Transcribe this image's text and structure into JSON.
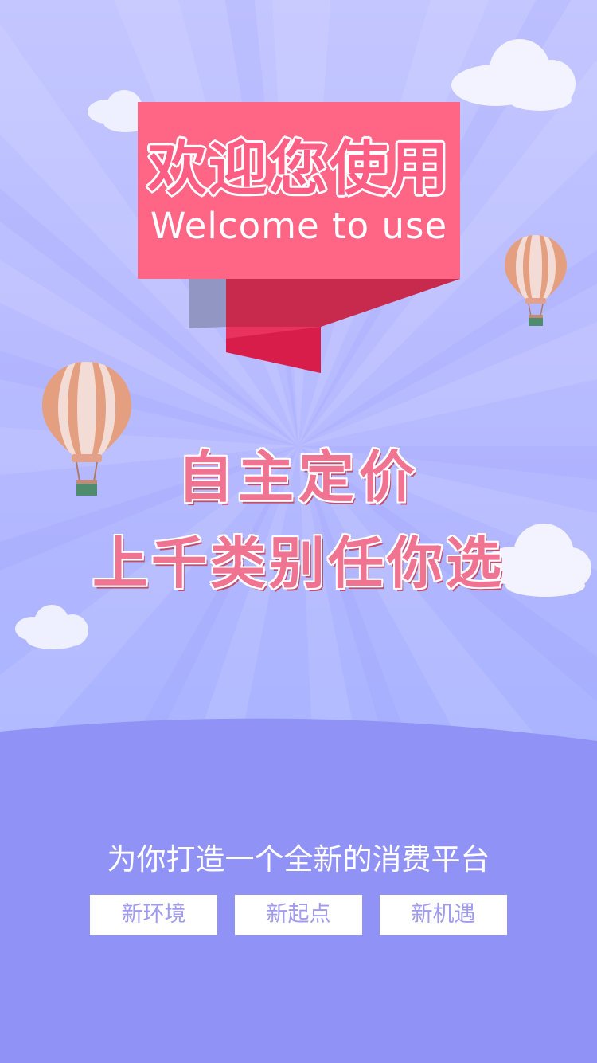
{
  "banner": {
    "title": "欢迎您使用",
    "subtitle": "Welcome to use"
  },
  "slogan": {
    "line1": "自主定价",
    "line2": "上千类别任你选"
  },
  "tagline": "为你打造一个全新的消费平台",
  "tags": [
    {
      "label": "新环境"
    },
    {
      "label": "新起点"
    },
    {
      "label": "新机遇"
    }
  ],
  "colors": {
    "sky": "#b8bbff",
    "ground": "#9192f5",
    "banner": "#ff6685",
    "ribbon_dark": "#c72a4d",
    "ribbon_mid": "#ea3c66",
    "ribbon_shadow": "#9196c2",
    "tag_text": "#9f9bf0",
    "slogan": "#f07392"
  },
  "icons": {
    "balloons": [
      "hot-air-balloon-icon",
      "hot-air-balloon-icon"
    ],
    "clouds": [
      "cloud-icon",
      "cloud-icon",
      "cloud-icon",
      "cloud-icon"
    ]
  }
}
